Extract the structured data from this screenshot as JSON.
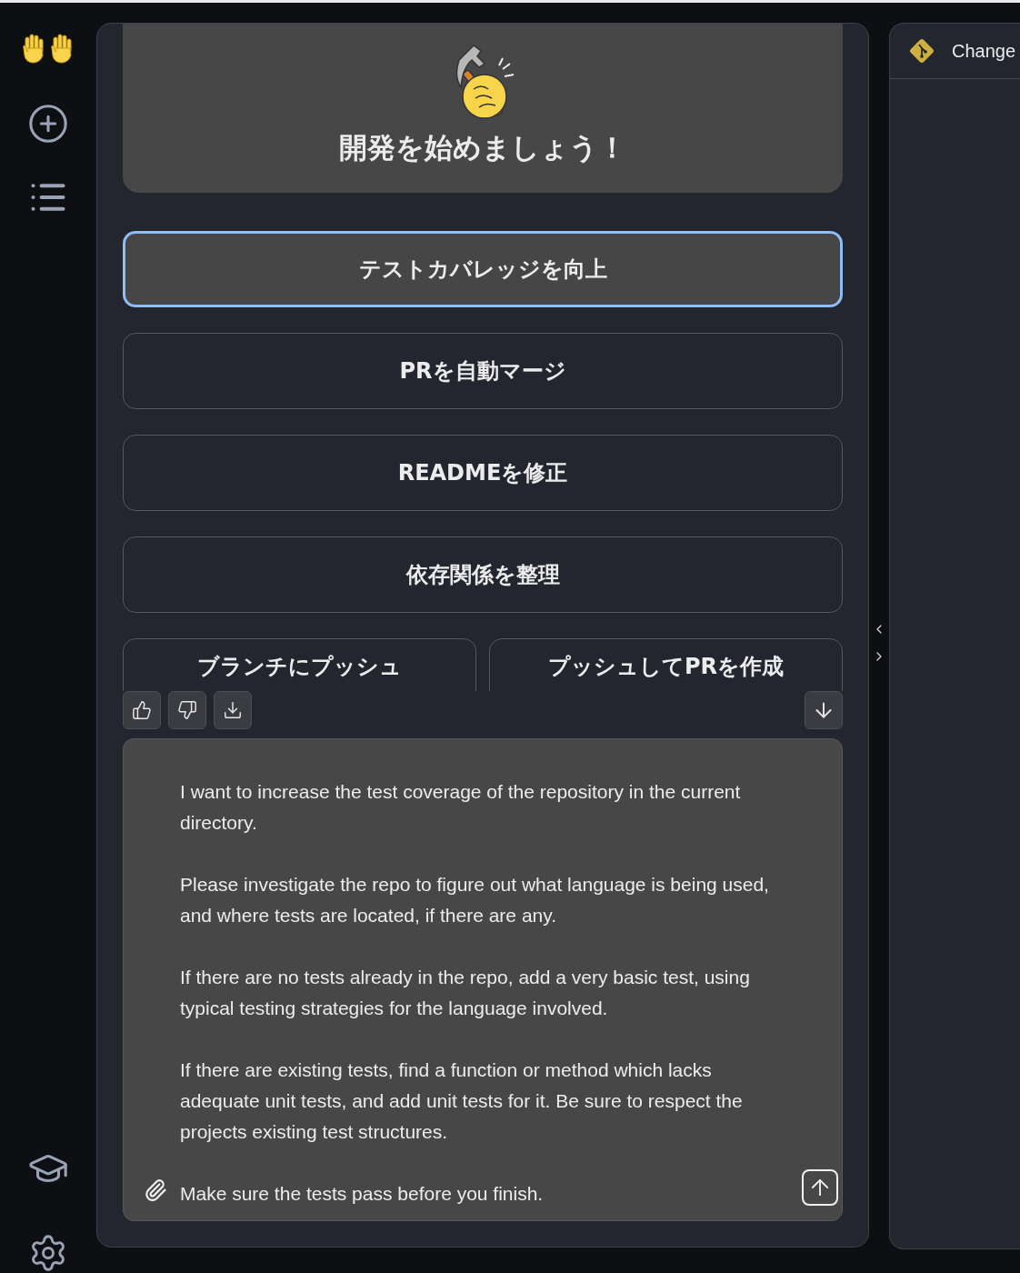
{
  "sidebar": {
    "items": [
      {
        "kind": "logo"
      },
      {
        "kind": "new-chat"
      },
      {
        "kind": "list"
      },
      {
        "kind": "learn"
      },
      {
        "kind": "settings"
      }
    ]
  },
  "hero": {
    "title": "開発を始めましょう！"
  },
  "suggestions": [
    {
      "label": "テストカバレッジを向上",
      "selected": true
    },
    {
      "label": "PRを自動マージ",
      "selected": false
    },
    {
      "label": "READMEを修正",
      "selected": false
    },
    {
      "label": "依存関係を整理",
      "selected": false
    }
  ],
  "partial_suggestions": [
    {
      "label": "ブランチにプッシュ"
    },
    {
      "label": "プッシュしてPRを作成"
    }
  ],
  "toolbar": {
    "actions": [
      {
        "kind": "like"
      },
      {
        "kind": "dislike"
      },
      {
        "kind": "download"
      }
    ],
    "scroll": {
      "kind": "down"
    }
  },
  "prompt": {
    "value": "I want to increase the test coverage of the repository in the current directory.\n\nPlease investigate the repo to figure out what language is being used, and where tests are located, if there are any.\n\nIf there are no tests already in the repo, add a very basic test, using typical testing strategies for the language involved.\n\nIf there are existing tests, find a function or method which lacks adequate unit tests, and add unit tests for it. Be sure to respect the projects existing test structures.\n\nMake sure the tests pass before you finish."
  },
  "side_panel": {
    "title": "Change"
  }
}
